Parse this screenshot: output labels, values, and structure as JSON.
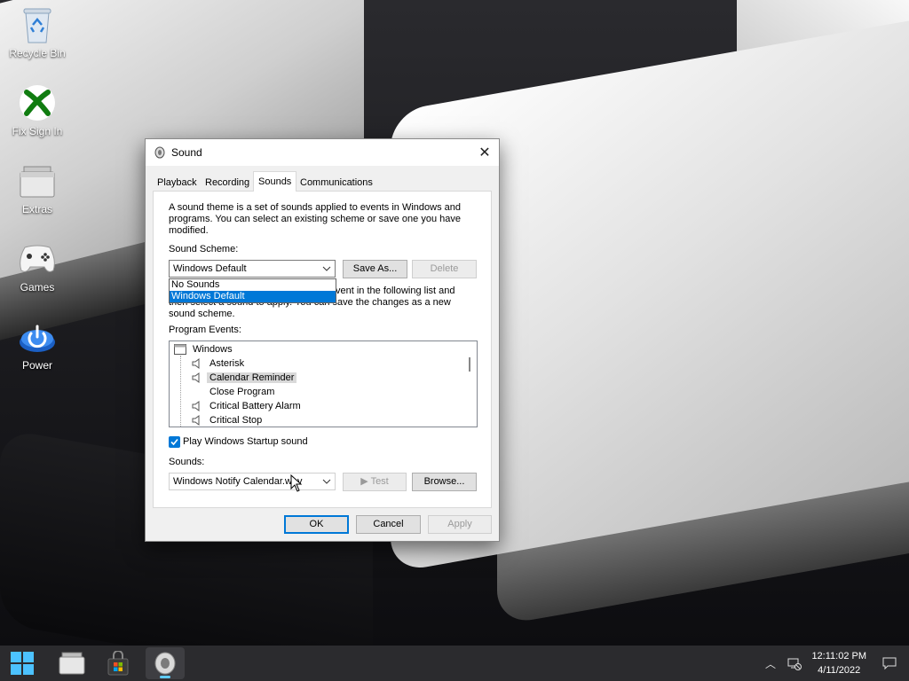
{
  "desktop": {
    "icons": [
      {
        "label": "Recycle Bin",
        "icon": "recycle-bin-icon"
      },
      {
        "label": "Fix Sign In",
        "icon": "xbox-icon"
      },
      {
        "label": "Extras",
        "icon": "folder-icon"
      },
      {
        "label": "Games",
        "icon": "gamepad-icon"
      },
      {
        "label": "Power",
        "icon": "power-icon"
      }
    ]
  },
  "dialog": {
    "title": "Sound",
    "close_icon": "close-icon",
    "tabs": [
      {
        "label": "Playback",
        "active": false
      },
      {
        "label": "Recording",
        "active": false
      },
      {
        "label": "Sounds",
        "active": true
      },
      {
        "label": "Communications",
        "active": false
      }
    ],
    "intro": "A sound theme is a set of sounds applied to events in Windows and programs.  You can select an existing scheme or save one you have modified.",
    "scheme_label": "Sound Scheme:",
    "scheme_value": "Windows Default",
    "scheme_options": [
      "No Sounds",
      "Windows Default"
    ],
    "save_as_label": "Save As...",
    "delete_label": "Delete",
    "change_text_line1": "vent in the following list and",
    "change_text_line2": "then select a sound to apply.  You can save the changes as a new",
    "change_text_line3": "sound scheme.",
    "events_label": "Program Events:",
    "events": [
      {
        "label": "Windows",
        "type": "group"
      },
      {
        "label": "Asterisk",
        "type": "sound"
      },
      {
        "label": "Calendar Reminder",
        "type": "sound",
        "selected": true
      },
      {
        "label": "Close Program",
        "type": "silent"
      },
      {
        "label": "Critical Battery Alarm",
        "type": "sound"
      },
      {
        "label": "Critical Stop",
        "type": "sound"
      }
    ],
    "startup_checkbox_label": "Play Windows Startup sound",
    "startup_checked": true,
    "sounds_label": "Sounds:",
    "sound_value": "Windows Notify Calendar.wav",
    "test_label": "Test",
    "browse_label": "Browse...",
    "ok_label": "OK",
    "cancel_label": "Cancel",
    "apply_label": "Apply"
  },
  "taskbar": {
    "apps": [
      "start-icon",
      "file-explorer-icon",
      "store-icon",
      "sound-settings-icon"
    ],
    "time": "12:11:02 PM",
    "date": "4/11/2022"
  },
  "colors": {
    "accent": "#0078d7",
    "dialog_bg": "#f0f0f0",
    "taskbar_bg": "#2b2b2e"
  }
}
